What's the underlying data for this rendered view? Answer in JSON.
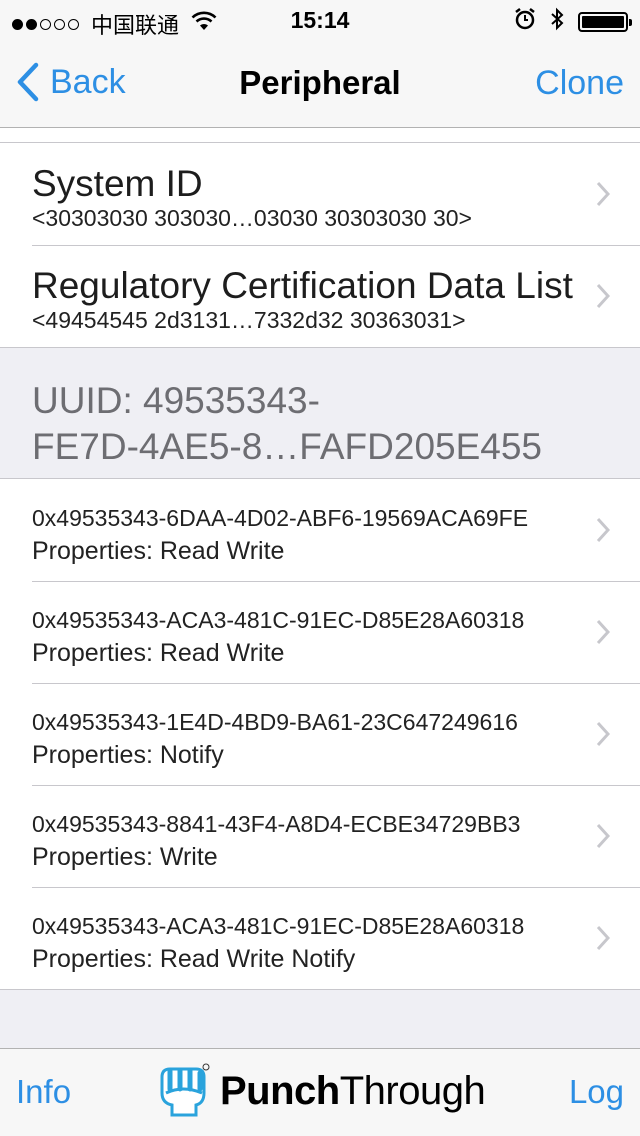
{
  "status_bar": {
    "carrier": "中国联通",
    "time": "15:14"
  },
  "nav": {
    "back_label": "Back",
    "title": "Peripheral",
    "clone_label": "Clone"
  },
  "info_rows": [
    {
      "title": "System ID",
      "value": "<30303030 303030…03030 30303030 30>"
    },
    {
      "title": "Regulatory Certification Data List",
      "value": "<49454545 2d3131…7332d32 30363031>"
    }
  ],
  "service": {
    "header_line1": "UUID: 49535343-",
    "header_line2": "FE7D-4AE5-8…FAFD205E455"
  },
  "characteristics": [
    {
      "uuid": "0x49535343-6DAA-4D02-ABF6-19569ACA69FE",
      "properties": "Properties: Read Write"
    },
    {
      "uuid": "0x49535343-ACA3-481C-91EC-D85E28A60318",
      "properties": "Properties: Read Write"
    },
    {
      "uuid": "0x49535343-1E4D-4BD9-BA61-23C647249616",
      "properties": "Properties: Notify"
    },
    {
      "uuid": "0x49535343-8841-43F4-A8D4-ECBE34729BB3",
      "properties": "Properties: Write"
    },
    {
      "uuid": "0x49535343-ACA3-481C-91EC-D85E28A60318",
      "properties": "Properties: Read Write Notify"
    }
  ],
  "tabbar": {
    "info_label": "Info",
    "brand_bold": "Punch",
    "brand_regular": "Through",
    "log_label": "Log"
  },
  "colors": {
    "accent": "#2d8fe4",
    "brand_logo": "#2aa3dc"
  },
  "icons": {
    "back": "chevron-left-icon",
    "row_disclosure": "chevron-right-icon",
    "brand": "fist-logo-icon"
  }
}
